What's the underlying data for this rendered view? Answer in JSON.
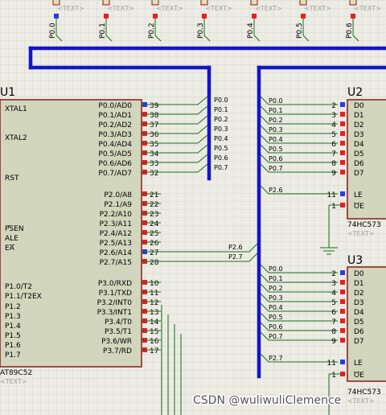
{
  "top_probes": {
    "tag": "<TEXT>",
    "labels": [
      "P0.0",
      "P0.1",
      "P0.2",
      "P0.3",
      "P0.4",
      "P0.5",
      "P0.6"
    ]
  },
  "u1": {
    "ref": "U1",
    "part": "AT89C52",
    "tag": "<TEXT>",
    "left_pins": [
      "XTAL1",
      "XTAL2",
      "RST",
      "PSEN",
      "ALE",
      "EA",
      "P1.0/T2",
      "P1.1/T2EX",
      "P1.2",
      "P1.3",
      "P1.4",
      "P1.5",
      "P1.6",
      "P1.7"
    ],
    "port0": {
      "names": [
        "P0.0/AD0",
        "P0.1/AD1",
        "P0.2/AD2",
        "P0.3/AD3",
        "P0.4/AD4",
        "P0.5/AD5",
        "P0.6/AD6",
        "P0.7/AD7"
      ],
      "nums": [
        "39",
        "38",
        "37",
        "36",
        "35",
        "34",
        "33",
        "32"
      ]
    },
    "port2": {
      "names": [
        "P2.0/A8",
        "P2.1/A9",
        "P2.2/A10",
        "P2.3/A11",
        "P2.4/A12",
        "P2.5/A13",
        "P2.6/A14",
        "P2.7/A15"
      ],
      "nums": [
        "21",
        "22",
        "23",
        "24",
        "25",
        "26",
        "27",
        "28"
      ]
    },
    "port3": {
      "names": [
        "P3.0/RXD",
        "P3.1/TXD",
        "P3.2/INT0",
        "P3.3/INT1",
        "P3.4/T0",
        "P3.5/T1",
        "P3.6/WR",
        "P3.7/RD"
      ],
      "nums": [
        "10",
        "11",
        "12",
        "13",
        "14",
        "15",
        "16",
        "17"
      ]
    }
  },
  "u1_net_labels": [
    "P0.0",
    "P0.1",
    "P0.2",
    "P0.3",
    "P0.4",
    "P0.5",
    "P0.6",
    "P0.7"
  ],
  "u1_p2_labels": [
    "P2.6",
    "P2.7"
  ],
  "u2": {
    "ref": "U2",
    "part": "74HC573",
    "tag": "<TEXT>",
    "in_labels": [
      "P0.0",
      "P0.1",
      "P0.2",
      "P0.3",
      "P0.4",
      "P0.5",
      "P0.6",
      "P0.7"
    ],
    "le_label": "P2.6",
    "nums": [
      "2",
      "3",
      "4",
      "5",
      "6",
      "7",
      "8",
      "9"
    ],
    "le_num": "11",
    "oe_num": "1",
    "pins": [
      "D0",
      "D1",
      "D2",
      "D3",
      "D4",
      "D5",
      "D6",
      "D7"
    ],
    "le": "LE",
    "oe": "OE"
  },
  "u3": {
    "ref": "U3",
    "part": "74HC573",
    "tag": "<TEXT>",
    "in_labels": [
      "P0.0",
      "P0.1",
      "P0.2",
      "P0.3",
      "P0.4",
      "P0.5",
      "P0.6",
      "P0.7"
    ],
    "le_label": "P2.7",
    "nums": [
      "2",
      "3",
      "4",
      "5",
      "6",
      "7",
      "8",
      "9"
    ],
    "le_num": "11",
    "oe_num": "1",
    "pins": [
      "D0",
      "D1",
      "D2",
      "D3",
      "D4",
      "D5",
      "D6",
      "D7"
    ],
    "le": "LE",
    "oe": "OE"
  },
  "watermark": "CSDN @wuliwuliClemence",
  "colors": {
    "background": "#ecece4",
    "grid": "#d6d6cc",
    "wire": "#1a6e1a",
    "bus": "#1414c8",
    "chip_fill": "#d2d6bc",
    "chip_border": "#8b1a1a",
    "pin_red": "#e62020",
    "pin_blue": "#2a3ce0",
    "text": "#000000",
    "tag": "#a0a0a0"
  }
}
